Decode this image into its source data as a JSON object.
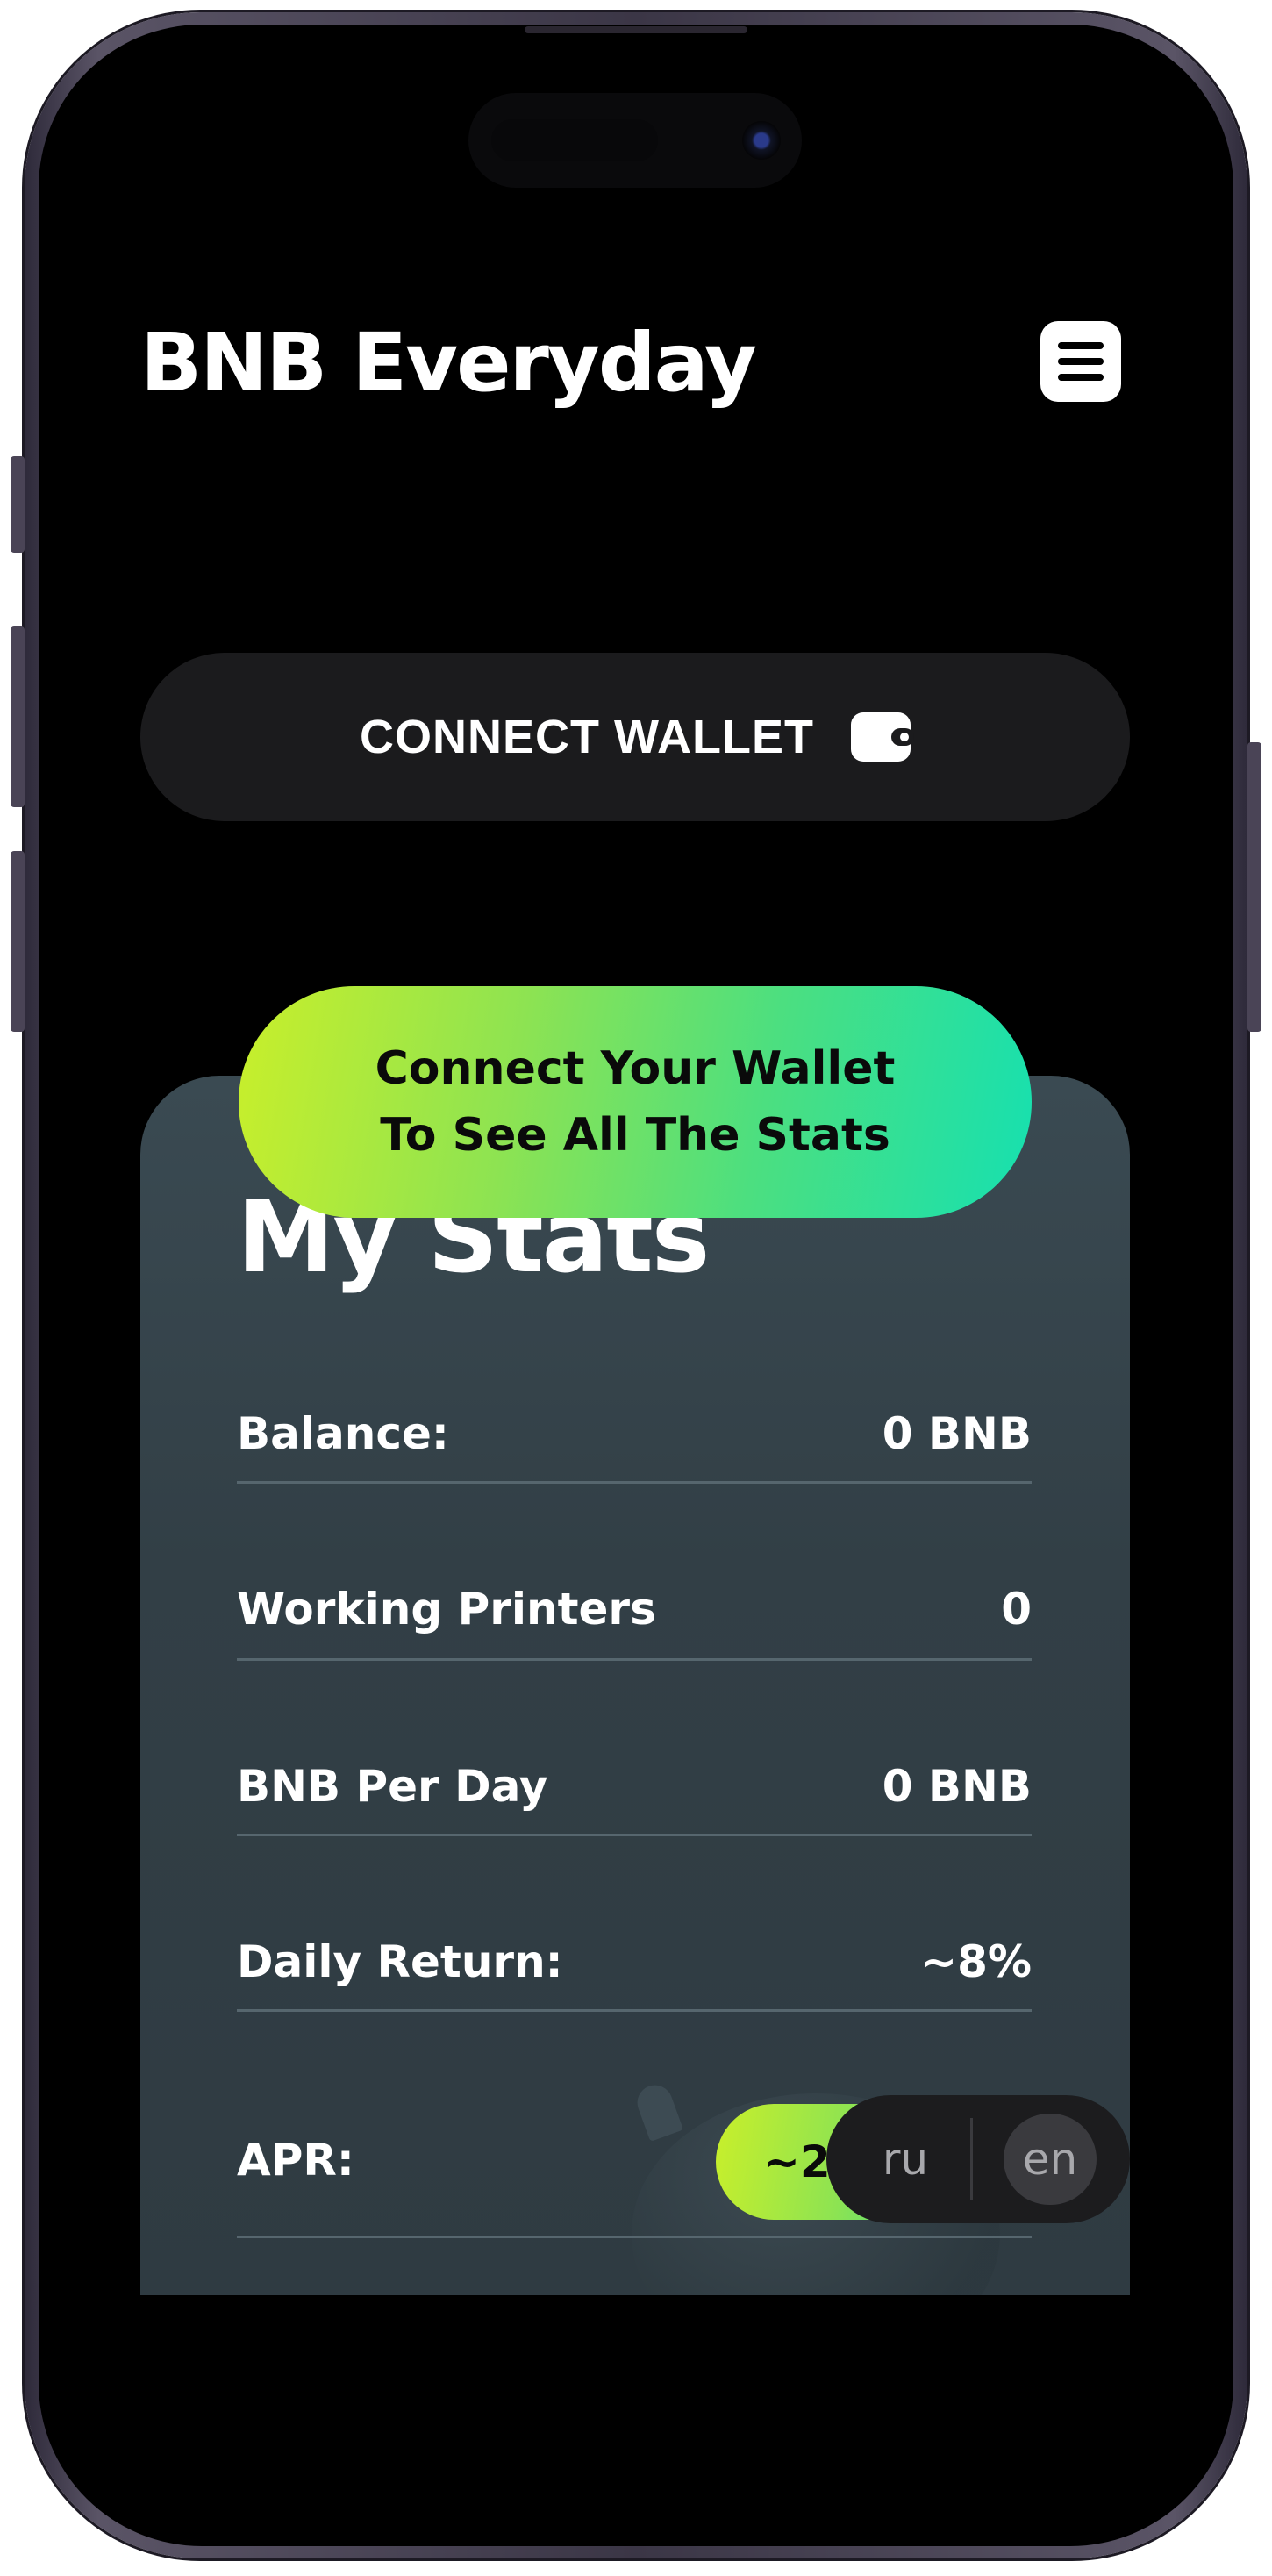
{
  "app": {
    "title": "BNB Everyday",
    "menu_icon": "hamburger-menu-icon"
  },
  "connect_wallet": {
    "label": "CONNECT WALLET",
    "icon": "wallet-icon"
  },
  "banner": {
    "line1": "Connect Your Wallet",
    "line2": "To See All The Stats"
  },
  "stats": {
    "title": "My Stats",
    "rows": [
      {
        "label": "Balance:",
        "value": "0 BNB"
      },
      {
        "label": "Working Printers",
        "value": "0"
      },
      {
        "label": "BNB Per Day",
        "value": "0 BNB"
      },
      {
        "label": "Daily Return:",
        "value": "~8%"
      },
      {
        "label": "APR:",
        "value": "~2"
      }
    ]
  },
  "language": {
    "options": [
      "ru",
      "en"
    ],
    "selected": "en"
  },
  "colors": {
    "background": "#000000",
    "card": "#34434a",
    "accent_start": "#c9ef2a",
    "accent_end": "#16e0b0",
    "button_dark": "#1b1b1d"
  }
}
